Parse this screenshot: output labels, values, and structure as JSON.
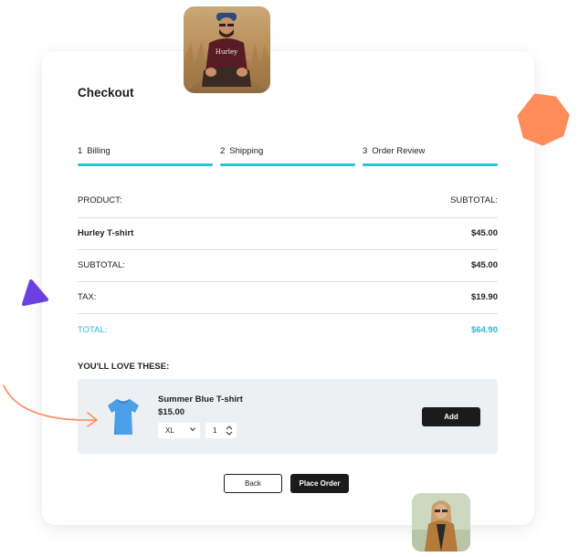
{
  "checkout": {
    "title": "Checkout",
    "steps": [
      {
        "number": "1",
        "label": "Billing"
      },
      {
        "number": "2",
        "label": "Shipping"
      },
      {
        "number": "3",
        "label": "Order Review"
      }
    ],
    "accent_color": "#29c1dd",
    "table": {
      "header": {
        "label": "PRODUCT:",
        "value": "SUBTOTAL:"
      },
      "rows": [
        {
          "label": "Hurley T-shirt",
          "value": "$45.00"
        },
        {
          "label": "SUBTOTAL:",
          "value": "$45.00"
        },
        {
          "label": "TAX:",
          "value": "$19.90"
        }
      ],
      "total": {
        "label": "TOTAL:",
        "value": "$64.90"
      }
    },
    "recommend": {
      "title": "YOU'LL LOVE THESE:",
      "item": {
        "name": "Summer Blue T-shirt",
        "price": "$15.00",
        "size": "XL",
        "quantity": "1",
        "add_label": "Add"
      }
    },
    "actions": {
      "back_label": "Back",
      "place_order_label": "Place Order"
    }
  },
  "decor": {
    "hexagon_color": "#ff8c5a",
    "triangle_color": "#6b3fe0",
    "arrow_color": "#ff8c5a"
  }
}
